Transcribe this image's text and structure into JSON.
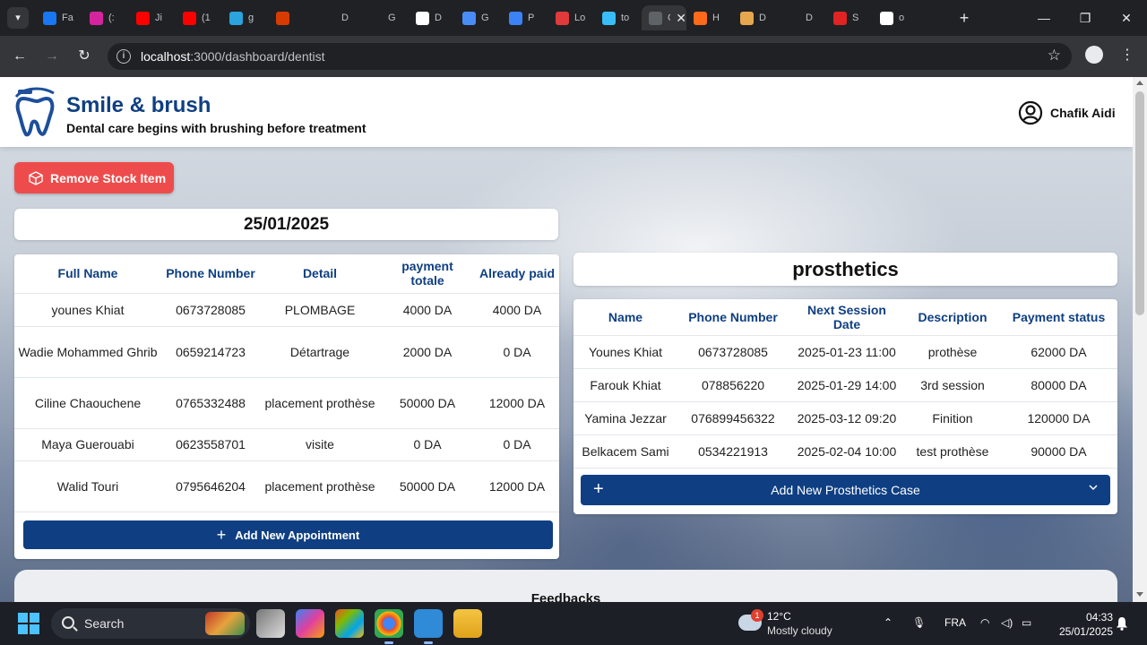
{
  "browser": {
    "tabs": [
      {
        "title": "Fa",
        "icon": "facebook-icon",
        "color": "#1877f2"
      },
      {
        "title": "(:",
        "icon": "instagram-icon",
        "color": "#d6249f"
      },
      {
        "title": "Ji",
        "icon": "youtube-icon",
        "color": "#ff0000"
      },
      {
        "title": "(1",
        "icon": "youtube-icon",
        "color": "#ff0000"
      },
      {
        "title": "g",
        "icon": "telegram-icon",
        "color": "#2aa3df"
      },
      {
        "title": "",
        "icon": "office365-icon",
        "color": "#d83b01"
      },
      {
        "title": "D",
        "icon": "chatgpt-icon",
        "color": "#202124"
      },
      {
        "title": "G",
        "icon": "github-icon",
        "color": "#202124"
      },
      {
        "title": "D",
        "icon": "dev-icon",
        "color": "#ffffff"
      },
      {
        "title": "G",
        "icon": "gemini-icon",
        "color": "#4a8cf7"
      },
      {
        "title": "P",
        "icon": "formidable-icon",
        "color": "#3b82f6"
      },
      {
        "title": "Lo",
        "icon": "lucid-icon",
        "color": "#e03a3a"
      },
      {
        "title": "to",
        "icon": "tailwind-icon",
        "color": "#38bdf8"
      },
      {
        "title": "C",
        "icon": "page-icon",
        "color": "#5f6368",
        "active": true
      },
      {
        "title": "H",
        "icon": "headspace-icon",
        "color": "#ff6a1a"
      },
      {
        "title": "D",
        "icon": "design-icon",
        "color": "#e7a74e"
      },
      {
        "title": "D",
        "icon": "dribbble-icon",
        "color": "#202124"
      },
      {
        "title": "S",
        "icon": "screen-icon",
        "color": "#e02424"
      },
      {
        "title": "o",
        "icon": "google-icon",
        "color": "#ffffff"
      }
    ],
    "url_host": "localhost",
    "url_path": ":3000/dashboard/dentist"
  },
  "header": {
    "brand_title": "Smile & brush",
    "brand_subtitle": "Dental care begins with brushing before treatment",
    "user_name": "Chafik Aidi"
  },
  "actions": {
    "remove_stock": "Remove Stock Item"
  },
  "appointments": {
    "date": "25/01/2025",
    "columns": [
      "Full Name",
      "Phone Number",
      "Detail",
      "payment totale",
      "Already paid"
    ],
    "rows": [
      [
        "younes Khiat",
        "0673728085",
        "PLOMBAGE",
        "4000 DA",
        "4000 DA"
      ],
      [
        "Wadie Mohammed Ghrib",
        "0659214723",
        "Détartrage",
        "2000 DA",
        "0 DA"
      ],
      [
        "Ciline Chaouchene",
        "0765332488",
        "placement prothèse",
        "50000 DA",
        "12000 DA"
      ],
      [
        "Maya Guerouabi",
        "0623558701",
        "visite",
        "0 DA",
        "0 DA"
      ],
      [
        "Walid Touri",
        "0795646204",
        "placement prothèse",
        "50000 DA",
        "12000 DA"
      ]
    ],
    "add_button": "Add New Appointment"
  },
  "prosthetics": {
    "title": "prosthetics",
    "columns": [
      "Name",
      "Phone Number",
      "Next Session Date",
      "Description",
      "Payment status"
    ],
    "rows": [
      [
        "Younes Khiat",
        "0673728085",
        "2025-01-23 11:00",
        "prothèse",
        "62000 DA"
      ],
      [
        "Farouk Khiat",
        "078856220",
        "2025-01-29 14:00",
        "3rd session",
        "80000 DA"
      ],
      [
        "Yamina Jezzar",
        "076899456322",
        "2025-03-12 09:20",
        "Finition",
        "120000 DA"
      ],
      [
        "Belkacem Sami",
        "0534221913",
        "2025-02-04 10:00",
        "test prothèse",
        "90000 DA"
      ]
    ],
    "add_button": "Add New Prosthetics Case"
  },
  "feedbacks": {
    "title": "Feedbacks"
  },
  "taskbar": {
    "search_label": "Search",
    "weather_badge": "1",
    "temperature": "12°C",
    "condition": "Mostly cloudy",
    "language": "FRA",
    "time": "04:33",
    "date": "25/01/2025"
  },
  "colors": {
    "brand_blue": "#0f3f82",
    "danger_red": "#ee4c4c"
  }
}
